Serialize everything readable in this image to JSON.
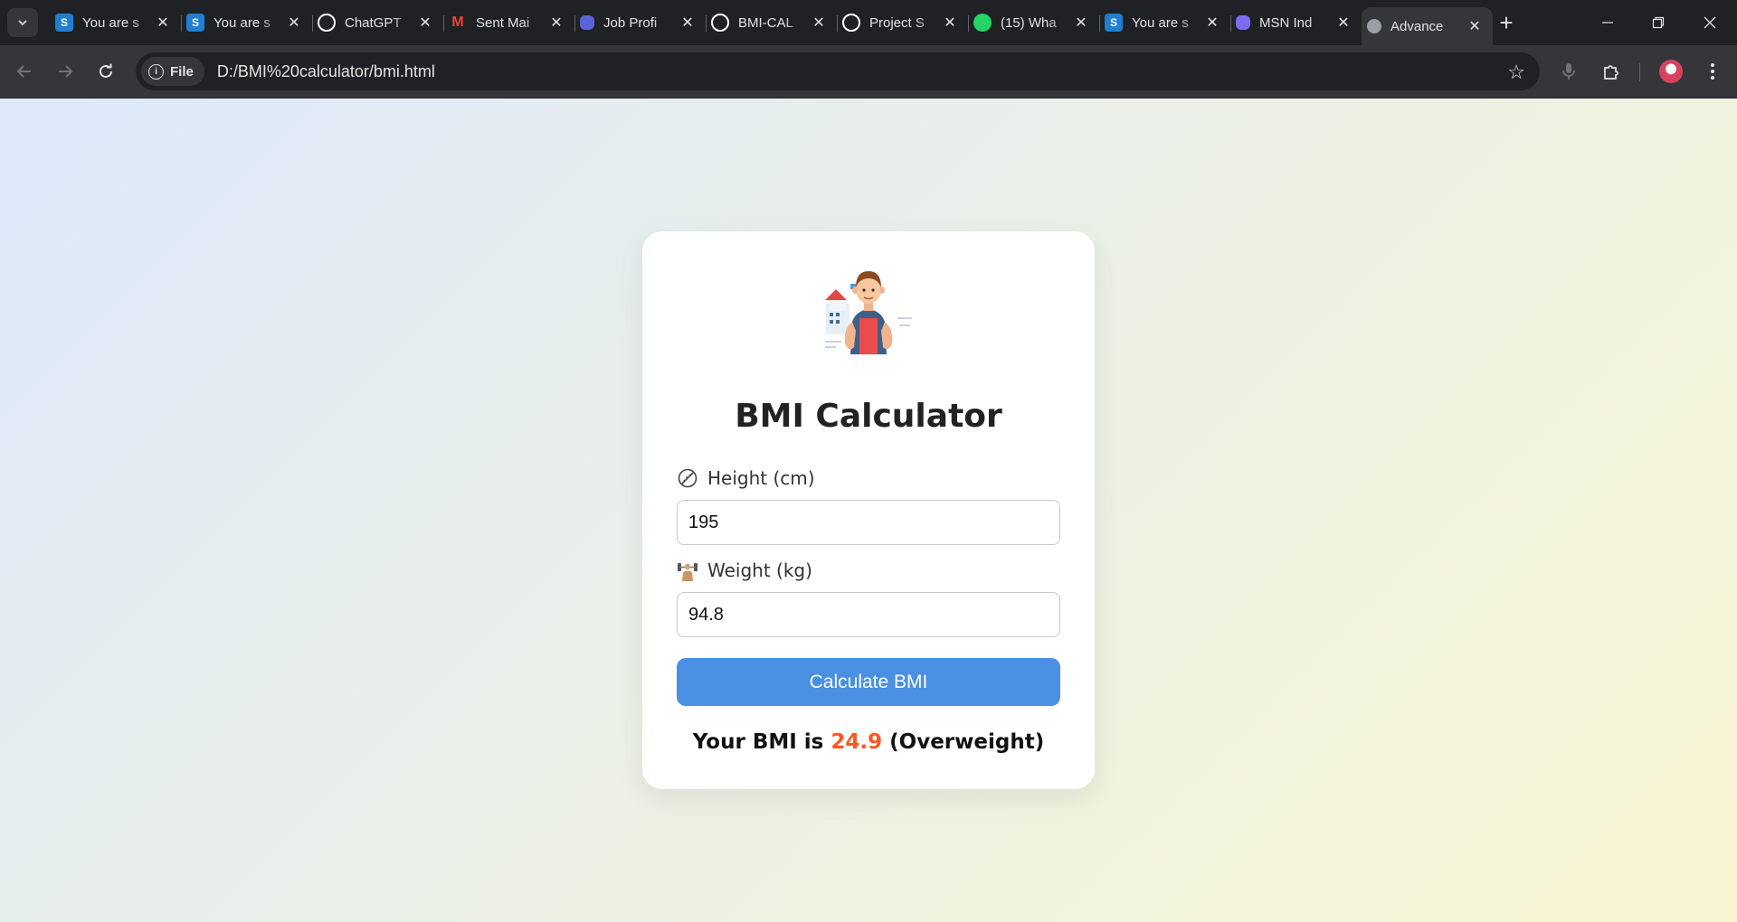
{
  "browser": {
    "tabs": [
      {
        "title": "You are s",
        "favicon": "scribd-s-icon",
        "color": "#1e7fd3"
      },
      {
        "title": "You are s",
        "favicon": "scribd-s-icon",
        "color": "#1e7fd3"
      },
      {
        "title": "ChatGPT",
        "favicon": "openai-icon",
        "color": "#ffffff"
      },
      {
        "title": "Sent Mai",
        "favicon": "gmail-icon",
        "color": "#ea4335"
      },
      {
        "title": "Job Profi",
        "favicon": "job-portal-icon",
        "color": "#5b63d8"
      },
      {
        "title": "BMI-CAL",
        "favicon": "github-icon",
        "color": "#ffffff"
      },
      {
        "title": "Project S",
        "favicon": "openai-icon",
        "color": "#ffffff"
      },
      {
        "title": "(15) Wha",
        "favicon": "whatsapp-icon",
        "color": "#25d366"
      },
      {
        "title": "You are s",
        "favicon": "scribd-s-icon",
        "color": "#1e7fd3"
      },
      {
        "title": "MSN Ind",
        "favicon": "msn-icon",
        "color": "#7b6cf6"
      },
      {
        "title": "Advance",
        "favicon": "globe-icon",
        "color": "#9aa0a6",
        "active": true
      }
    ],
    "omnibox": {
      "chip_label": "File",
      "url": "D:/BMI%20calculator/bmi.html"
    }
  },
  "app": {
    "title": "BMI Calculator",
    "height": {
      "label": "Height (cm)",
      "value": "195"
    },
    "weight": {
      "label": "Weight (kg)",
      "value": "94.8"
    },
    "button_label": "Calculate BMI",
    "result": {
      "prefix": "Your BMI is ",
      "value": "24.9",
      "category": " (Overweight)",
      "value_color": "#ff5722"
    },
    "accent_color": "#4a90e2"
  }
}
